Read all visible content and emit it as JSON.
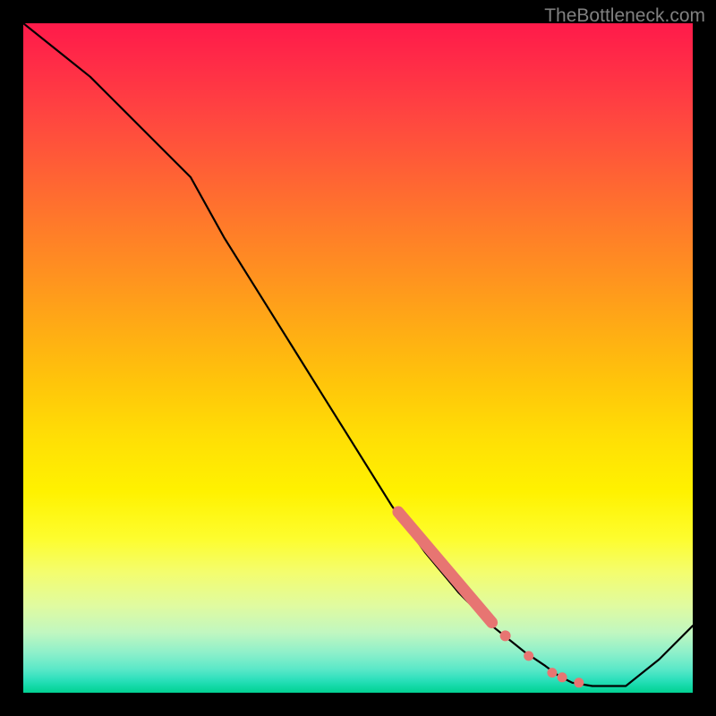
{
  "watermark": "TheBottleneck.com",
  "chart_data": {
    "type": "line",
    "title": "",
    "xlabel": "",
    "ylabel": "",
    "xlim": [
      0,
      100
    ],
    "ylim": [
      0,
      100
    ],
    "grid": false,
    "gradient_stops": [
      {
        "pos": 0,
        "color": "#ff1a4a"
      },
      {
        "pos": 50,
        "color": "#ffc000"
      },
      {
        "pos": 80,
        "color": "#fdfd2e"
      },
      {
        "pos": 100,
        "color": "#02d292"
      }
    ],
    "series": [
      {
        "name": "main-curve",
        "color": "#000000",
        "x": [
          0,
          5,
          10,
          15,
          20,
          25,
          30,
          35,
          40,
          45,
          50,
          55,
          60,
          65,
          70,
          75,
          78,
          80,
          82,
          85,
          90,
          95,
          100
        ],
        "y": [
          100,
          96,
          92,
          87,
          82,
          77,
          68,
          60,
          52,
          44,
          36,
          28,
          21,
          15,
          10,
          6,
          4,
          2.5,
          1.5,
          1,
          1,
          5,
          10
        ]
      }
    ],
    "highlight_segment": {
      "color": "#e77572",
      "thick_segment": {
        "x": [
          56,
          70
        ],
        "y": [
          27,
          10.5
        ]
      },
      "dots": [
        {
          "x": 72,
          "y": 8.5
        },
        {
          "x": 75.5,
          "y": 5.5
        },
        {
          "x": 79,
          "y": 3.0
        },
        {
          "x": 80.5,
          "y": 2.3
        },
        {
          "x": 83,
          "y": 1.5
        }
      ]
    }
  }
}
